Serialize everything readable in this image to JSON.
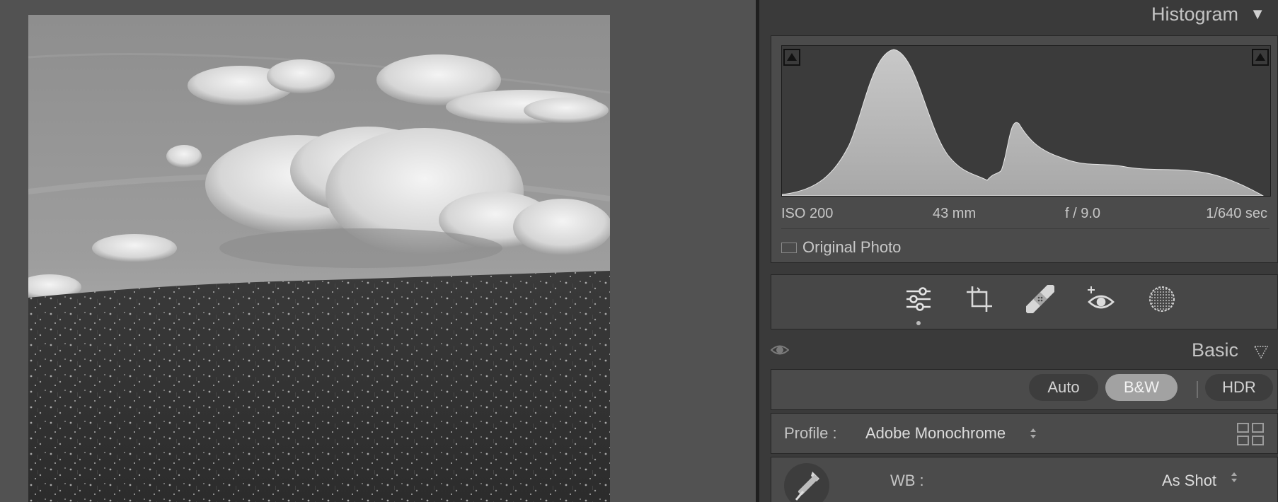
{
  "histogram": {
    "title": "Histogram",
    "exif": {
      "iso": "ISO 200",
      "focal": "43 mm",
      "aperture": "f / 9.0",
      "shutter": "1/640 sec"
    },
    "original_photo_label": "Original Photo"
  },
  "tools": [
    "edit-sliders-icon",
    "crop-icon",
    "healing-icon",
    "red-eye-icon",
    "masking-icon"
  ],
  "basic": {
    "title": "Basic",
    "buttons": {
      "auto": "Auto",
      "bw": "B&W",
      "hdr": "HDR"
    },
    "active_button": "bw",
    "profile_label": "Profile :",
    "profile_value": "Adobe Monochrome",
    "wb_label": "WB :",
    "wb_value": "As Shot"
  },
  "colors": {
    "panel": "#3a3a3a",
    "viewer": "#525252",
    "active_pill": "#a2a2a2"
  }
}
